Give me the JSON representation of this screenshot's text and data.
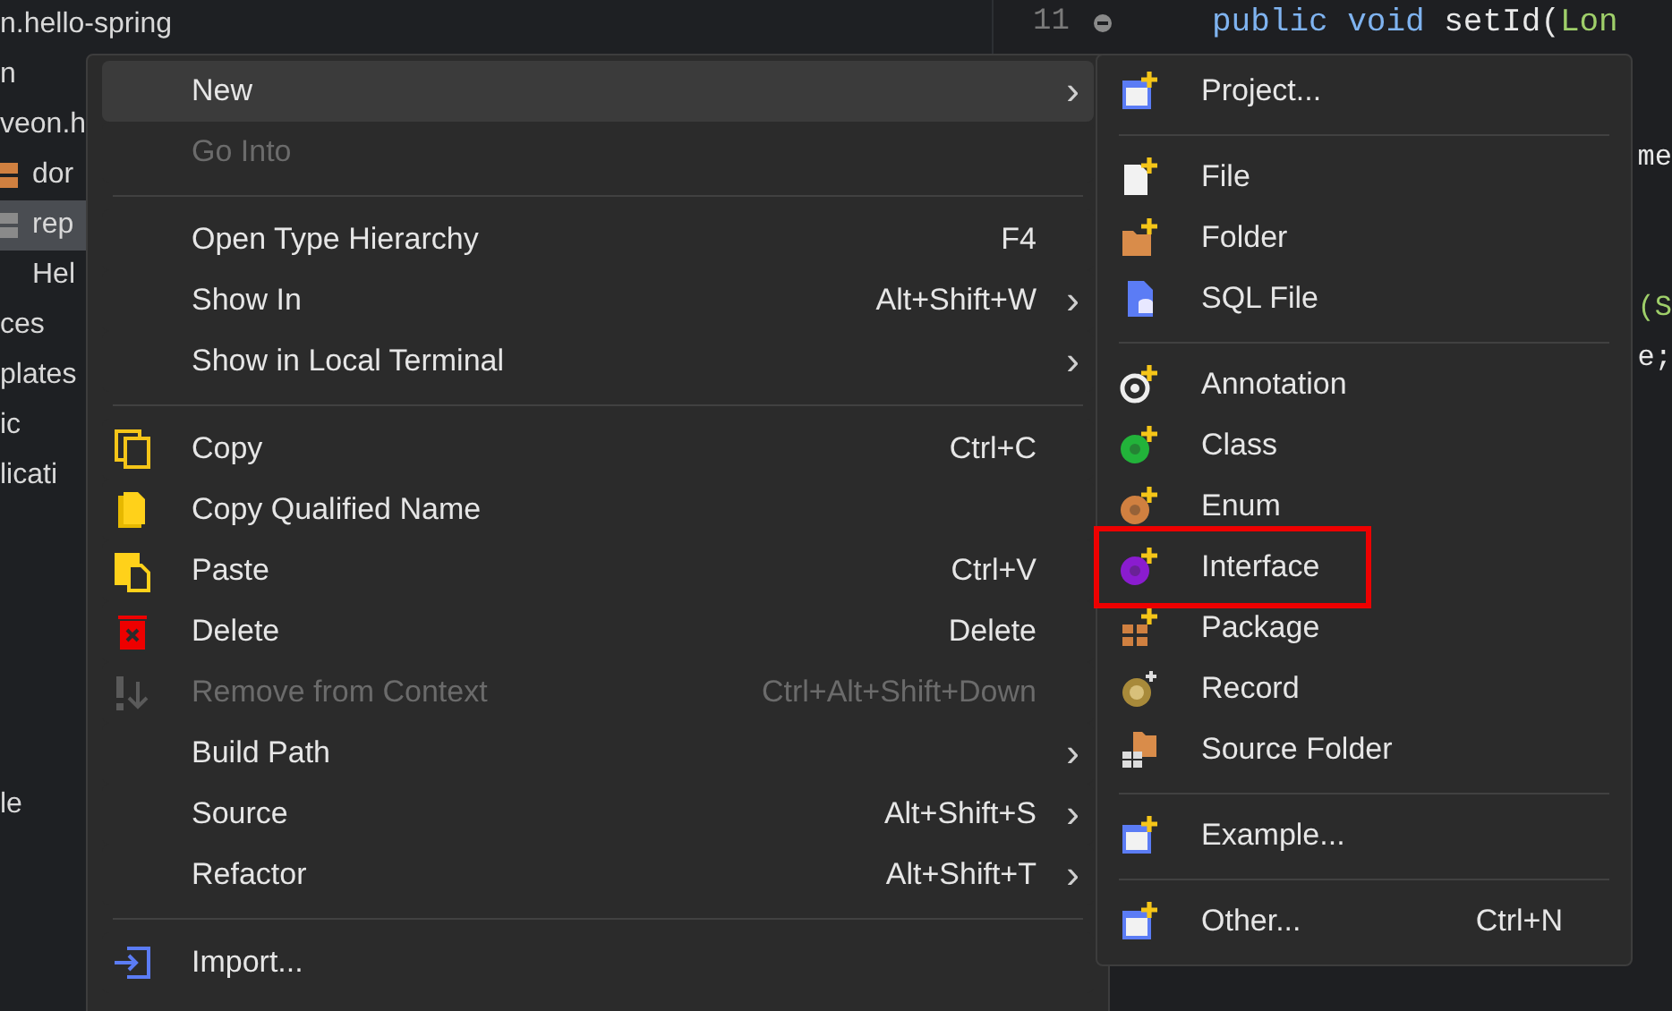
{
  "explorer": {
    "items": [
      {
        "label": "n.hello-spring",
        "selected": false,
        "kind": "text"
      },
      {
        "label": "n",
        "selected": false,
        "kind": "text"
      },
      {
        "label": "veon.h",
        "selected": false,
        "kind": "text"
      },
      {
        "label": "dor",
        "selected": false,
        "kind": "package"
      },
      {
        "label": "rep",
        "selected": true,
        "kind": "package"
      },
      {
        "label": "Hel",
        "selected": false,
        "kind": "indented"
      },
      {
        "label": "ces",
        "selected": false,
        "kind": "text"
      },
      {
        "label": "plates",
        "selected": false,
        "kind": "text"
      },
      {
        "label": "ic",
        "selected": false,
        "kind": "text"
      },
      {
        "label": "licati",
        "selected": false,
        "kind": "text"
      }
    ],
    "bottom_items": [
      {
        "label": "le",
        "selected": false,
        "kind": "text"
      }
    ]
  },
  "editor": {
    "line_number": "11",
    "code": [
      {
        "text": "public void ",
        "kind": "keyword"
      },
      {
        "text": "setId(",
        "kind": "plain"
      },
      {
        "text": "Lon",
        "kind": "type"
      }
    ],
    "fragments": [
      {
        "text": "me",
        "kind": "plain"
      },
      {
        "text": "(S",
        "kind": "type"
      },
      {
        "text": "e;",
        "kind": "plain"
      }
    ]
  },
  "context_menu": {
    "items": [
      {
        "kind": "item",
        "label": "New",
        "submenu": true,
        "disabled": false,
        "selected": true
      },
      {
        "kind": "item",
        "label": "Go Into",
        "disabled": true,
        "selected": false
      },
      {
        "kind": "separator"
      },
      {
        "kind": "item",
        "label": "Open Type Hierarchy",
        "shortcut": "F4",
        "disabled": false,
        "selected": false
      },
      {
        "kind": "item",
        "label": "Show In",
        "shortcut": "Alt+Shift+W",
        "submenu": true,
        "disabled": false,
        "selected": false
      },
      {
        "kind": "item",
        "label": "Show in Local Terminal",
        "submenu": true,
        "disabled": false,
        "selected": false
      },
      {
        "kind": "separator"
      },
      {
        "kind": "item",
        "label": "Copy",
        "shortcut": "Ctrl+C",
        "disabled": false,
        "selected": false
      },
      {
        "kind": "item",
        "label": "Copy Qualified Name",
        "disabled": false,
        "selected": false
      },
      {
        "kind": "item",
        "label": "Paste",
        "shortcut": "Ctrl+V",
        "disabled": false,
        "selected": false
      },
      {
        "kind": "item",
        "label": "Delete",
        "shortcut": "Delete",
        "disabled": false,
        "selected": false
      },
      {
        "kind": "item",
        "label": "Remove from Context",
        "shortcut": "Ctrl+Alt+Shift+Down",
        "disabled": true,
        "selected": false
      },
      {
        "kind": "item",
        "label": "Build Path",
        "submenu": true,
        "disabled": false,
        "selected": false
      },
      {
        "kind": "item",
        "label": "Source",
        "shortcut": "Alt+Shift+S",
        "submenu": true,
        "disabled": false,
        "selected": false
      },
      {
        "kind": "item",
        "label": "Refactor",
        "shortcut": "Alt+Shift+T",
        "submenu": true,
        "disabled": false,
        "selected": false
      },
      {
        "kind": "separator"
      },
      {
        "kind": "item",
        "label": "Import...",
        "disabled": false,
        "selected": false
      }
    ],
    "chevron": "›"
  },
  "submenu": {
    "items": [
      {
        "kind": "item",
        "label": "Project...",
        "outlined": false
      },
      {
        "kind": "separator"
      },
      {
        "kind": "item",
        "label": "File",
        "outlined": false
      },
      {
        "kind": "item",
        "label": "Folder",
        "outlined": false
      },
      {
        "kind": "item",
        "label": "SQL File",
        "outlined": false
      },
      {
        "kind": "separator"
      },
      {
        "kind": "item",
        "label": "Annotation",
        "outlined": false
      },
      {
        "kind": "item",
        "label": "Class",
        "outlined": false
      },
      {
        "kind": "item",
        "label": "Enum",
        "outlined": false
      },
      {
        "kind": "item",
        "label": "Interface",
        "outlined": true
      },
      {
        "kind": "item",
        "label": "Package",
        "outlined": false
      },
      {
        "kind": "item",
        "label": "Record",
        "outlined": false
      },
      {
        "kind": "item",
        "label": "Source Folder",
        "outlined": false
      },
      {
        "kind": "separator"
      },
      {
        "kind": "item",
        "label": "Example...",
        "outlined": false
      },
      {
        "kind": "separator"
      },
      {
        "kind": "item",
        "label": "Other...",
        "shortcut": "Ctrl+N",
        "outlined": false
      }
    ]
  }
}
